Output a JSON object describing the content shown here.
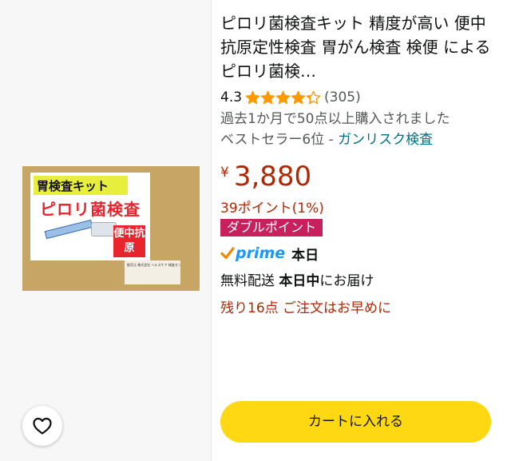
{
  "product": {
    "title": "ピロリ菌検査キット 精度が高い 便中抗原定性検査 胃がん検査 検便 による ピロリ菌検…",
    "rating_value": "4.3",
    "rating_stars": 4.3,
    "review_count": "(305)",
    "purchase_note": "過去1か月で50点以上購入されました",
    "bestseller_prefix": "ベストセラー6位 - ",
    "bestseller_category": "ガンリスク検査",
    "currency_symbol": "¥",
    "price": "3,880",
    "points": "39ポイント(1%)",
    "double_points_badge": "ダブルポイント",
    "prime_label": "prime",
    "prime_day": "本日",
    "delivery_prefix": "無料配送 ",
    "delivery_bold": "本日中",
    "delivery_suffix": "にお届け",
    "stock_note": "残り16点 ご注文はお早めに",
    "add_to_cart_label": "カートに入れる"
  },
  "image": {
    "box_title": "胃検査キット",
    "box_main": "ピロリ菌検査",
    "box_side": "便中抗原",
    "box_label": "販売元 株式会社 ヘルスケア 検査センター"
  },
  "icons": {
    "wishlist": "heart-outline-icon",
    "star": "star-icon",
    "prime_check": "check-icon"
  },
  "colors": {
    "star": "#ff9900",
    "price": "#b12704",
    "link": "#007185",
    "badge": "#c7205d",
    "cart_button": "#ffd814",
    "prime": "#1a98ff"
  }
}
